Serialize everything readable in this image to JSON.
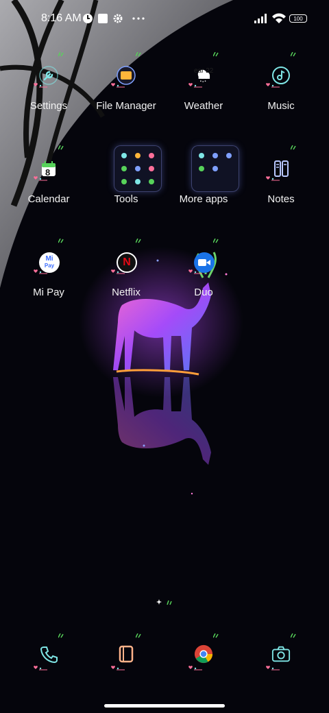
{
  "status_bar": {
    "time": "8:16 AM",
    "battery_level": "100",
    "icons": [
      "clock-icon",
      "square-notification-icon",
      "gear-icon",
      "more-dots-icon",
      "signal-icon",
      "wifi-icon",
      "battery-icon"
    ]
  },
  "apps": [
    {
      "label": "Settings",
      "icon": "wrench-icon"
    },
    {
      "label": "File Manager",
      "icon": "folder-icon"
    },
    {
      "label": "Weather",
      "icon": "cloud-icon",
      "badge": "ear 22"
    },
    {
      "label": "Music",
      "icon": "music-note-icon"
    },
    {
      "label": "Calendar",
      "icon": "calendar-icon",
      "day": "8"
    },
    {
      "label": "Tools",
      "icon": "folder-grid-icon"
    },
    {
      "label": "More apps",
      "icon": "folder-grid-icon"
    },
    {
      "label": "Notes",
      "icon": "notes-icon"
    },
    {
      "label": "Mi Pay",
      "icon": "mipay-icon",
      "icon_text_top": "Mi",
      "icon_text_bottom": "Pay"
    },
    {
      "label": "Netflix",
      "icon": "netflix-icon",
      "icon_text": "N"
    },
    {
      "label": "Duo",
      "icon": "video-camera-icon"
    }
  ],
  "dock": [
    {
      "name": "phone",
      "icon": "phone-icon"
    },
    {
      "name": "notebook",
      "icon": "notebook-icon"
    },
    {
      "name": "chrome",
      "icon": "chrome-icon"
    },
    {
      "name": "camera",
      "icon": "camera-icon"
    }
  ],
  "colors": {
    "background": "#05050c",
    "accent_cyan": "#7fe6e6",
    "accent_pink": "#ff6f9a",
    "accent_green": "#57d25a",
    "accent_purple": "#b04cff"
  }
}
